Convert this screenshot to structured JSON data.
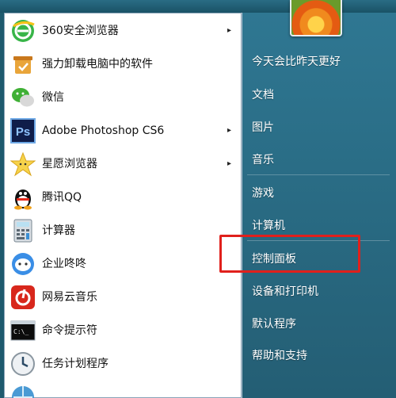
{
  "programs": [
    {
      "label": "360安全浏览器",
      "icon": "360-browser-icon",
      "has_submenu": true
    },
    {
      "label": "强力卸载电脑中的软件",
      "icon": "uninstall-icon",
      "has_submenu": false
    },
    {
      "label": "微信",
      "icon": "wechat-icon",
      "has_submenu": false
    },
    {
      "label": "Adobe Photoshop CS6",
      "icon": "photoshop-icon",
      "icon_text": "Ps",
      "has_submenu": true
    },
    {
      "label": "星愿浏览器",
      "icon": "star-browser-icon",
      "has_submenu": true
    },
    {
      "label": "腾讯QQ",
      "icon": "qq-icon",
      "has_submenu": false
    },
    {
      "label": "计算器",
      "icon": "calculator-icon",
      "has_submenu": false
    },
    {
      "label": "企业咚咚",
      "icon": "dongdong-icon",
      "has_submenu": false
    },
    {
      "label": "网易云音乐",
      "icon": "netease-music-icon",
      "has_submenu": false
    },
    {
      "label": "命令提示符",
      "icon": "cmd-icon",
      "icon_text": "C:\\_",
      "has_submenu": false
    },
    {
      "label": "任务计划程序",
      "icon": "task-scheduler-icon",
      "has_submenu": false
    }
  ],
  "submenu_arrow": "▸",
  "right_links": [
    {
      "label": "今天会比昨天更好"
    },
    {
      "label": "文档"
    },
    {
      "label": "图片"
    },
    {
      "label": "音乐"
    },
    {
      "label": "游戏"
    },
    {
      "label": "计算机"
    },
    {
      "label": "控制面板"
    },
    {
      "label": "设备和打印机"
    },
    {
      "label": "默认程序"
    },
    {
      "label": "帮助和支持"
    }
  ],
  "colors": {
    "highlight": "#e0201c",
    "right_pane": "#2a6d86"
  }
}
